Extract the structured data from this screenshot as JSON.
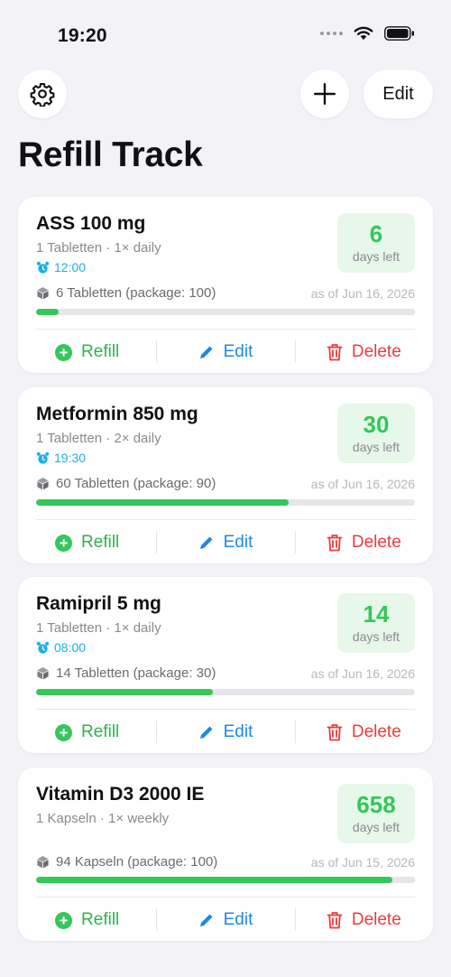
{
  "status_bar": {
    "time": "19:20"
  },
  "header": {
    "edit_label": "Edit",
    "title": "Refill Track"
  },
  "actions": {
    "refill": "Refill",
    "edit": "Edit",
    "delete": "Delete"
  },
  "days_left_label": "days left",
  "colors": {
    "accent_green": "#34c759",
    "edit_blue": "#1e88e5",
    "delete_red": "#ee3b3b",
    "alarm_blue": "#1ab0e6"
  },
  "medications": [
    {
      "name": "ASS 100 mg",
      "dose": "1 Tabletten · 1× daily",
      "alarm": "12:00",
      "days": "6",
      "stock": "6 Tabletten (package: 100)",
      "as_of": "as of Jun 16, 2026",
      "progress": 0.06
    },
    {
      "name": "Metformin 850 mg",
      "dose": "1 Tabletten · 2× daily",
      "alarm": "19:30",
      "days": "30",
      "stock": "60 Tabletten (package: 90)",
      "as_of": "as of Jun 16, 2026",
      "progress": 0.667
    },
    {
      "name": "Ramipril 5 mg",
      "dose": "1 Tabletten · 1× daily",
      "alarm": "08:00",
      "days": "14",
      "stock": "14 Tabletten (package: 30)",
      "as_of": "as of Jun 16, 2026",
      "progress": 0.467
    },
    {
      "name": "Vitamin D3 2000 IE",
      "dose": "1 Kapseln · 1× weekly",
      "days": "658",
      "stock": "94 Kapseln (package: 100)",
      "as_of": "as of Jun 15, 2026",
      "progress": 0.94
    }
  ]
}
